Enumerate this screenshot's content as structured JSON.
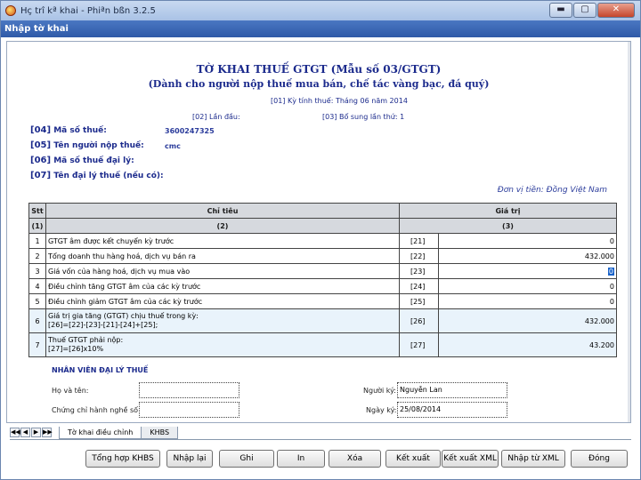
{
  "window": {
    "title": "Hç trî kª khai - Phiªn bßn 3.2.5",
    "subtitle": "Nhập tờ khai",
    "min_label": "▬",
    "max_label": "▢",
    "close_label": "✕"
  },
  "form": {
    "heading": "TỜ KHAI THUẾ GTGT (Mẫu số 03/GTGT)",
    "subheading": "(Dành cho người nộp thuế mua bán, chế tác vàng bạc, đá quý)",
    "period": "[01]   Kỳ tính thuế: Tháng 06 năm 2014",
    "first_time": "[02] Lần đầu:",
    "supplement": "[03] Bổ sung lần thứ:  1",
    "tax_id_code": "[04]",
    "tax_id_label": "Mã số thuế:",
    "tax_id_value": "3600247325",
    "taxpayer_code": "[05]",
    "taxpayer_label": "Tên người nộp thuế:",
    "taxpayer_value": "cmc",
    "agent_tax_id_code": "[06]",
    "agent_tax_id_label": "Mã số thuế đại lý:",
    "agent_name_code": "[07]",
    "agent_name_label": "Tên đại lý thuế (nếu có):",
    "currency": "Đơn vị tiền: Đồng Việt Nam"
  },
  "table": {
    "headers": [
      "Stt",
      "Chỉ tiêu",
      "Giá trị"
    ],
    "subheaders": [
      "(1)",
      "(2)",
      "(3)"
    ],
    "rows": [
      {
        "stt": "1",
        "desc": "GTGT âm được kết chuyển kỳ trước",
        "code": "[21]",
        "value": "0"
      },
      {
        "stt": "2",
        "desc": "Tổng doanh thu hàng hoá, dịch vụ bán ra",
        "code": "[22]",
        "value": "432.000"
      },
      {
        "stt": "3",
        "desc": "Giá vốn của hàng hoá, dịch vụ mua vào",
        "code": "[23]",
        "value": "0"
      },
      {
        "stt": "4",
        "desc": "Điều chỉnh tăng GTGT âm của các kỳ trước",
        "code": "[24]",
        "value": "0"
      },
      {
        "stt": "5",
        "desc": "Điều chỉnh giảm GTGT âm của các kỳ trước",
        "code": "[25]",
        "value": "0"
      },
      {
        "stt": "6",
        "desc1": "Giá trị gia tăng (GTGT) chịu thuế trong kỳ:",
        "desc2": "[26]=[22]-[23]-[21]-[24]+[25];",
        "code": "[26]",
        "value": "432.000"
      },
      {
        "stt": "7",
        "desc1": "Thuế GTGT phải nộp:",
        "desc2": "[27]=[26]x10%",
        "code": "[27]",
        "value": "43.200"
      }
    ]
  },
  "agent": {
    "title": "NHÂN VIÊN ĐẠI LÝ THUẾ",
    "name_label": "Họ và tên:",
    "cert_label": "Chứng chỉ hành nghề số",
    "signer_label": "Người ký:",
    "signer_value": "Nguyễn Lan",
    "sign_date_label": "Ngày ký:",
    "sign_date_value": "25/08/2014"
  },
  "tabs": {
    "nav": [
      "◀◀",
      "◀",
      "▶",
      "▶▶"
    ],
    "items": [
      "Tờ khai điều chỉnh",
      "KHBS"
    ]
  },
  "buttons": {
    "summary": "Tổng hợp KHBS",
    "reset": "Nhập lại",
    "save": "Ghi",
    "print": "In",
    "delete": "Xóa",
    "export": "Kết xuất",
    "export_xml": "Kết xuất XML",
    "import_xml": "Nhập từ XML",
    "close": "Đóng"
  }
}
